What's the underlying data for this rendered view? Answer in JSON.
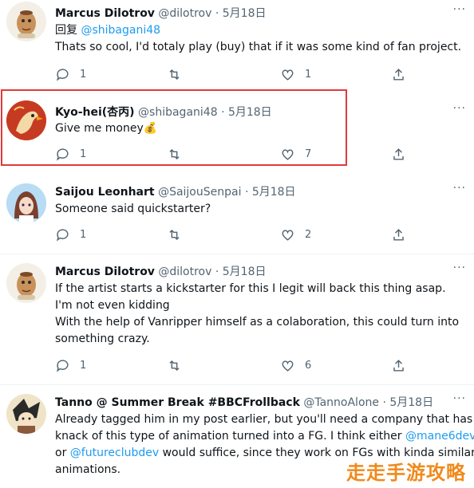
{
  "tweets": [
    {
      "name": "Marcus Dilotrov",
      "handle": "@dilotrov",
      "date": "· 5月18日",
      "more": "···",
      "lines": [
        "回复 @shibagani48",
        "Thats so cool, I'd totaly play (buy) that if it was some kind of fan project."
      ],
      "reply_prefix": "回复 ",
      "reply_mention": "@shibagani48",
      "reply_count": "1",
      "retweet_count": "",
      "like_count": "1"
    },
    {
      "name": "Kyo-hei(杏丙)",
      "handle": "@shibagani48",
      "date": "· 5月18日",
      "more": "···",
      "lines": [
        "Give me money💰"
      ],
      "reply_count": "1",
      "retweet_count": "",
      "like_count": "7"
    },
    {
      "name": "Saijou Leonhart",
      "handle": "@SaijouSenpai",
      "date": "· 5月18日",
      "more": "···",
      "lines": [
        "Someone said quickstarter?"
      ],
      "reply_count": "1",
      "retweet_count": "",
      "like_count": "2"
    },
    {
      "name": "Marcus Dilotrov",
      "handle": "@dilotrov",
      "date": "· 5月18日",
      "more": "···",
      "lines": [
        "If the artist starts a kickstarter for this I legit will back this thing asap.",
        "I'm not even kidding",
        "With the help of Vanripper himself as a colaboration, this could turn into",
        "something crazy."
      ],
      "reply_count": "1",
      "retweet_count": "",
      "like_count": "6"
    },
    {
      "name": "Tanno @ Summer Break #BBCFrollback",
      "handle": "@TannoAlone",
      "date": "· 5月18日",
      "more": "···",
      "lines": [
        "Already tagged him in my post earlier, but you'll need a company that has a",
        "knack of this type of animation turned into a FG. I think either ",
        "@mane6dev",
        "or ",
        "@futureclubdev",
        " would suffice, since they work on FGs with kinda similar",
        "animations."
      ]
    }
  ],
  "watermark": "走走手游攻略",
  "colors": {
    "accent": "#1d9bf0",
    "highlight_border": "#e03a3a",
    "muted": "#536471"
  },
  "icons": [
    "reply-icon",
    "retweet-icon",
    "like-icon",
    "share-icon",
    "more-icon"
  ]
}
